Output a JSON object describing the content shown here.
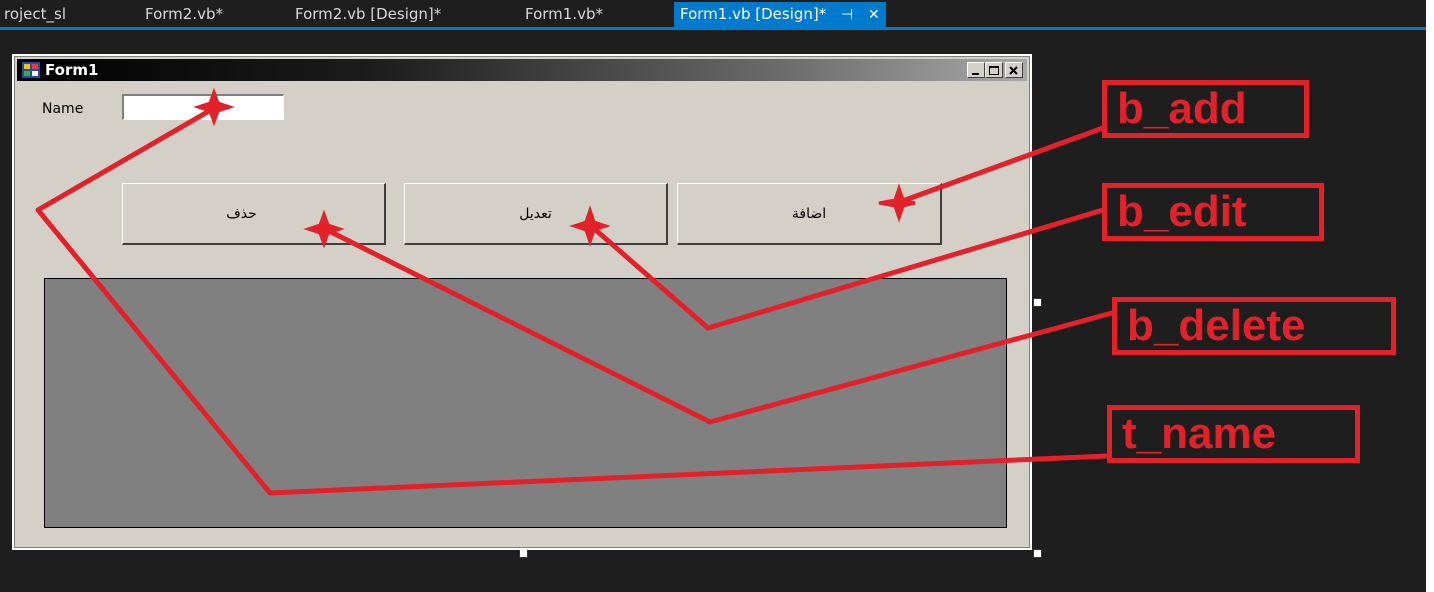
{
  "tabs": [
    {
      "label": "roject_sl"
    },
    {
      "label": "Form2.vb*"
    },
    {
      "label": "Form2.vb [Design]*"
    },
    {
      "label": "Form1.vb*"
    },
    {
      "label": "Form1.vb [Design]*",
      "active": true,
      "pin": "⊣",
      "close": "✕"
    }
  ],
  "form": {
    "title": "Form1",
    "caption_buttons": [
      "minimize-icon",
      "maximize-icon",
      "close-icon"
    ],
    "name_label": "Name",
    "name_value": "",
    "buttons": {
      "delete": "حذف",
      "edit": "تعديل",
      "add": "اضافة"
    }
  },
  "annotations": {
    "b_add": "b_add",
    "b_edit": "b_edit",
    "b_delete": "b_delete",
    "t_name": "t_name"
  },
  "colors": {
    "annotation": "#e3212a",
    "active_tab": "#007acc",
    "ide_background": "#1e1e1e",
    "form_face": "#d4d0c8",
    "grid_face": "#808080"
  }
}
